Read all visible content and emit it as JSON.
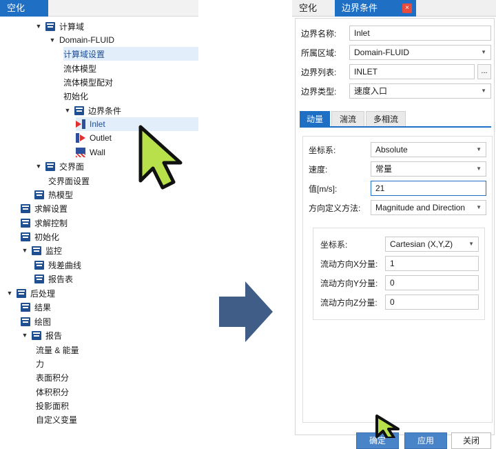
{
  "left": {
    "tab_label": "空化",
    "tree": [
      {
        "label": "计算域",
        "icon": "folder-icon",
        "arrow": "▼"
      },
      {
        "label": "Domain-FLUID",
        "icon": "",
        "arrow": "▼"
      },
      {
        "label": "计算域设置",
        "icon": "",
        "arrow": "",
        "selected": true
      },
      {
        "label": "流体模型",
        "icon": "",
        "arrow": ""
      },
      {
        "label": "流体模型配对",
        "icon": "",
        "arrow": ""
      },
      {
        "label": "初始化",
        "icon": "",
        "arrow": ""
      },
      {
        "label": "边界条件",
        "icon": "folder-icon",
        "arrow": "▼"
      },
      {
        "label": "Inlet",
        "icon": "inlet-icon",
        "arrow": "",
        "selected": true
      },
      {
        "label": "Outlet",
        "icon": "outlet-icon",
        "arrow": ""
      },
      {
        "label": "Wall",
        "icon": "wall-icon",
        "arrow": ""
      },
      {
        "label": "交界面",
        "icon": "folder-icon",
        "arrow": "▼"
      },
      {
        "label": "交界面设置",
        "icon": "",
        "arrow": ""
      },
      {
        "label": "热模型",
        "icon": "folder-icon",
        "arrow": ""
      },
      {
        "label": "求解设置",
        "icon": "folder-icon",
        "arrow": ""
      },
      {
        "label": "求解控制",
        "icon": "folder-icon",
        "arrow": ""
      },
      {
        "label": "初始化",
        "icon": "folder-icon",
        "arrow": ""
      },
      {
        "label": "监控",
        "icon": "folder-icon",
        "arrow": "▼"
      },
      {
        "label": "残差曲线",
        "icon": "folder-icon",
        "arrow": ""
      },
      {
        "label": "报告表",
        "icon": "folder-icon",
        "arrow": ""
      },
      {
        "label": "后处理",
        "icon": "folder-icon",
        "arrow": "▼"
      },
      {
        "label": "结果",
        "icon": "folder-icon",
        "arrow": ""
      },
      {
        "label": "绘图",
        "icon": "folder-icon",
        "arrow": ""
      },
      {
        "label": "报告",
        "icon": "folder-icon",
        "arrow": "▼"
      },
      {
        "label": "流量 & 能量",
        "icon": "",
        "arrow": ""
      },
      {
        "label": "力",
        "icon": "",
        "arrow": ""
      },
      {
        "label": "表面积分",
        "icon": "",
        "arrow": ""
      },
      {
        "label": "体积积分",
        "icon": "",
        "arrow": ""
      },
      {
        "label": "投影面积",
        "icon": "",
        "arrow": ""
      },
      {
        "label": "自定义变量",
        "icon": "",
        "arrow": ""
      }
    ]
  },
  "dialog": {
    "tab_inactive": "空化",
    "tab_active": "边界条件",
    "close_glyph": "×",
    "fields": {
      "name_label": "边界名称:",
      "name_value": "Inlet",
      "region_label": "所属区域:",
      "region_value": "Domain-FLUID",
      "list_label": "边界列表:",
      "list_value": "INLET",
      "list_button": "...",
      "type_label": "边界类型:",
      "type_value": "速度入口"
    },
    "subtabs": [
      "动量",
      "湍流",
      "多相流"
    ],
    "momentum": {
      "coord_label": "坐标系:",
      "coord_value": "Absolute",
      "speed_label": "速度:",
      "speed_value": "常量",
      "value_label": "值[m/s]:",
      "value_value": "21",
      "dir_label": "方向定义方法:",
      "dir_value": "Magnitude and Direction"
    },
    "direction": {
      "coord_label": "坐标系:",
      "coord_value": "Cartesian (X,Y,Z)",
      "x_label": "流动方向X分量:",
      "x_value": "1",
      "y_label": "流动方向Y分量:",
      "y_value": "0",
      "z_label": "流动方向Z分量:",
      "z_value": "0"
    },
    "buttons": {
      "ok": "确定",
      "apply": "应用",
      "close": "关闭"
    }
  },
  "colors": {
    "accent": "#1f6fc5",
    "folder": "#1f4e91",
    "cursor_fill": "#b7e04a",
    "arrow_fill": "#3f5d86"
  }
}
